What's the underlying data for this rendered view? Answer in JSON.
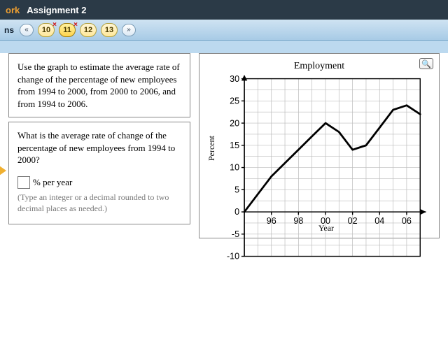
{
  "header": {
    "left": "ork",
    "title": "Assignment 2"
  },
  "nav": {
    "label": "ns",
    "items": [
      {
        "n": "10",
        "wrong": true,
        "current": false
      },
      {
        "n": "11",
        "wrong": true,
        "current": true
      },
      {
        "n": "12",
        "wrong": false,
        "current": false
      },
      {
        "n": "13",
        "wrong": false,
        "current": false
      }
    ]
  },
  "instruction": "Use the graph to estimate the average rate of change of the percentage of new employees from 1994 to 2000, from 2000 to 2006, and from 1994 to 2006.",
  "question": "What is the average rate of change of the percentage of new employees from 1994 to 2000?",
  "answer_unit": "% per year",
  "hint": "(Type an integer or a decimal rounded to two decimal places as needed.)",
  "chart_data": {
    "type": "line",
    "title": "Employment",
    "xlabel": "Year",
    "ylabel": "Percent",
    "xticks": [
      "96",
      "98",
      "00",
      "02",
      "04",
      "06"
    ],
    "yticks": [
      -10,
      -5,
      0,
      5,
      10,
      15,
      20,
      25,
      30
    ],
    "ylim": [
      -10,
      30
    ],
    "xlim_years": [
      1994,
      2007
    ],
    "series": [
      {
        "name": "Percent new employees",
        "x": [
          1994,
          1995,
          1996,
          1997,
          1998,
          1999,
          2000,
          2001,
          2002,
          2003,
          2004,
          2005,
          2006,
          2007
        ],
        "y": [
          0,
          4,
          8,
          11,
          14,
          17,
          20,
          18,
          14,
          15,
          19,
          23,
          24,
          22
        ]
      }
    ]
  }
}
